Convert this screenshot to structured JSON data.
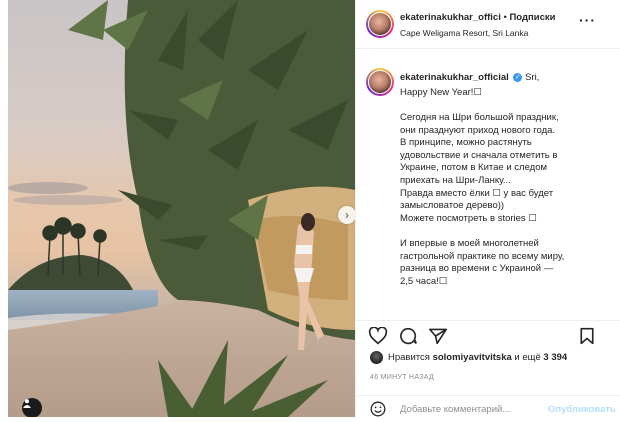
{
  "post_image": {
    "description_icon": "beach-photo",
    "next_icon": "chevron-right-icon",
    "tag_icon": "user-tag-icon"
  },
  "header": {
    "username": "ekaterinakukhar_offici",
    "dot": "•",
    "follow_label": "Подписки",
    "location": "Cape Weligama Resort, Sri Lanka",
    "more_icon": "more-options-icon"
  },
  "caption": {
    "username": "ekaterinakukhar_official",
    "first_text": "Sri,",
    "line2": "Happy New Year!☐",
    "body": "Сегодня на Шри большой праздник,\nони празднуют приход нового года.\nВ принципе, можно растянуть\nудовольствие и сначала отметить в\nУкраине, потом в Китае и следом\nприехать на Шри-Ланку...\nПравда вместо ёлки ☐ у вас будет\nзамысловатое дерево))\nМожете посмотреть в stories ☐\n\nИ впервые в моей многолетней\nгастрольной практике по всему миру,\nразница во времени с Украиной —\n2,5 часа!☐"
  },
  "actions": {
    "like_icon": "heart-icon",
    "comment_icon": "comment-icon",
    "share_icon": "share-icon",
    "save_icon": "bookmark-icon"
  },
  "likes": {
    "prefix": "Нравится",
    "user": "solomiyavitvitska",
    "connector": "и ещё",
    "count": "3 394"
  },
  "time_ago": "46 МИНУТ НАЗАД",
  "comment": {
    "placeholder": "Добавьте комментарий...",
    "publish_label": "Опубликовать"
  },
  "colors": {
    "verified": "#3897f0",
    "publish_disabled": "#b2dffc",
    "muted": "#8e8e8e"
  }
}
